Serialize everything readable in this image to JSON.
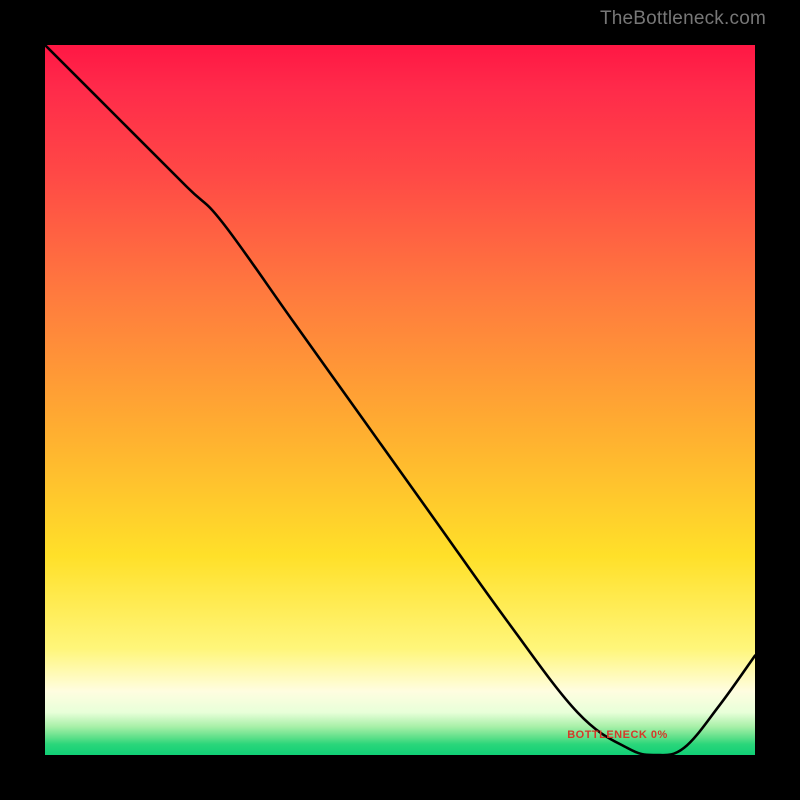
{
  "watermark": "TheBottleneck.com",
  "bottom_label": "BOTTLENECK 0%",
  "chart_data": {
    "type": "line",
    "title": "",
    "xlabel": "",
    "ylabel": "",
    "xlim": [
      0,
      100
    ],
    "ylim": [
      0,
      100
    ],
    "grid": false,
    "legend": false,
    "series": [
      {
        "name": "bottleneck-curve",
        "x": [
          0,
          10,
          20,
          25,
          35,
          45,
          55,
          65,
          75,
          82,
          86,
          90,
          95,
          100
        ],
        "y": [
          100,
          90,
          80,
          75,
          61,
          47,
          33,
          19,
          6,
          1,
          0,
          1,
          7,
          14
        ]
      }
    ],
    "annotations": [
      {
        "text_ref": "bottom_label",
        "x": 82,
        "y": 2
      }
    ],
    "colors": {
      "curve": "#000000",
      "gradient_top": "#ff1744",
      "gradient_mid": "#ffe029",
      "gradient_bottom": "#10cf76"
    }
  }
}
